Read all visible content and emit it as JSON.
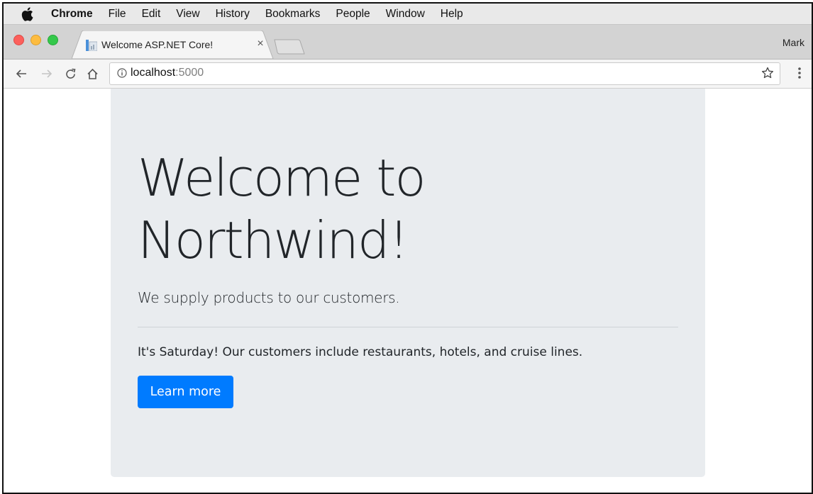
{
  "menubar": {
    "app": "Chrome",
    "items": [
      "File",
      "Edit",
      "View",
      "History",
      "Bookmarks",
      "People",
      "Window",
      "Help"
    ]
  },
  "tab": {
    "title": "Welcome ASP.NET Core!",
    "close": "×"
  },
  "profile": "Mark",
  "address": {
    "host": "localhost",
    "port": ":5000"
  },
  "page": {
    "heading_line1": "Welcome to",
    "heading_line2": "Northwind!",
    "lead": "We supply products to our customers.",
    "message": "It's Saturday! Our customers include restaurants, hotels, and cruise lines.",
    "button": "Learn more"
  },
  "colors": {
    "jumbotron_bg": "#e9ecef",
    "button_bg": "#007bff"
  },
  "icons": [
    "apple-icon",
    "favicon-icon",
    "back-icon",
    "forward-icon",
    "reload-icon",
    "home-icon",
    "info-icon",
    "bookmark-star-icon",
    "chrome-menu-icon"
  ]
}
